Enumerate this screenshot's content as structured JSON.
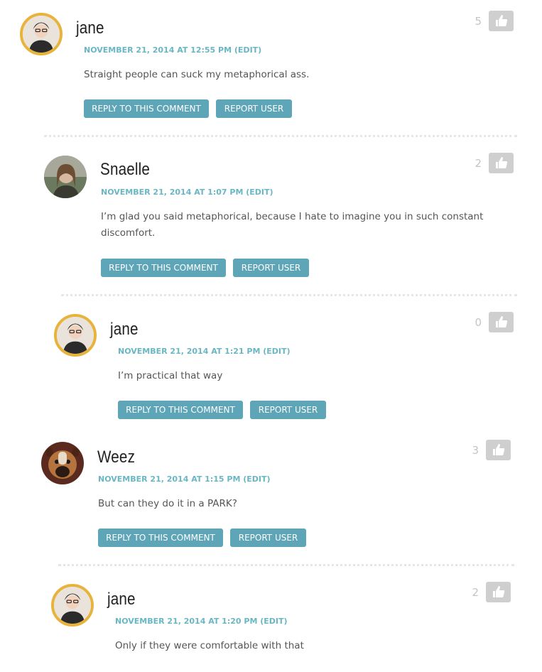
{
  "ui": {
    "reply_label": "REPLY TO THIS COMMENT",
    "report_label": "REPORT USER",
    "edit_label": "(EDIT)"
  },
  "colors": {
    "accent": "#6ab7c3",
    "button": "#5ea5b8",
    "like_button": "#cfcfcf",
    "avatar_ring": "#e8b33b"
  },
  "comments": [
    {
      "author": "jane",
      "date": "NOVEMBER 21, 2014 AT 12:55 PM",
      "text": "Straight people can suck my metaphorical ass.",
      "likes": "5",
      "avatar": "jane-avatar-icon"
    },
    {
      "author": "Snaelle",
      "date": "NOVEMBER 21, 2014 AT 1:07 PM",
      "text": "I’m glad you said metaphorical, because I hate to imagine you in such constant discomfort.",
      "likes": "2",
      "avatar": "snaelle-avatar-icon"
    },
    {
      "author": "jane",
      "date": "NOVEMBER 21, 2014 AT 1:21 PM",
      "text": "I’m practical that way",
      "likes": "0",
      "avatar": "jane-avatar-icon"
    },
    {
      "author": "Weez",
      "date": "NOVEMBER 21, 2014 AT 1:15 PM",
      "text": "But can they do it in a PARK?",
      "likes": "3",
      "avatar": "dog-avatar-icon"
    },
    {
      "author": "jane",
      "date": "NOVEMBER 21, 2014 AT 1:20 PM",
      "text": "Only if they were comfortable with that",
      "likes": "2",
      "avatar": "jane-avatar-icon"
    }
  ]
}
